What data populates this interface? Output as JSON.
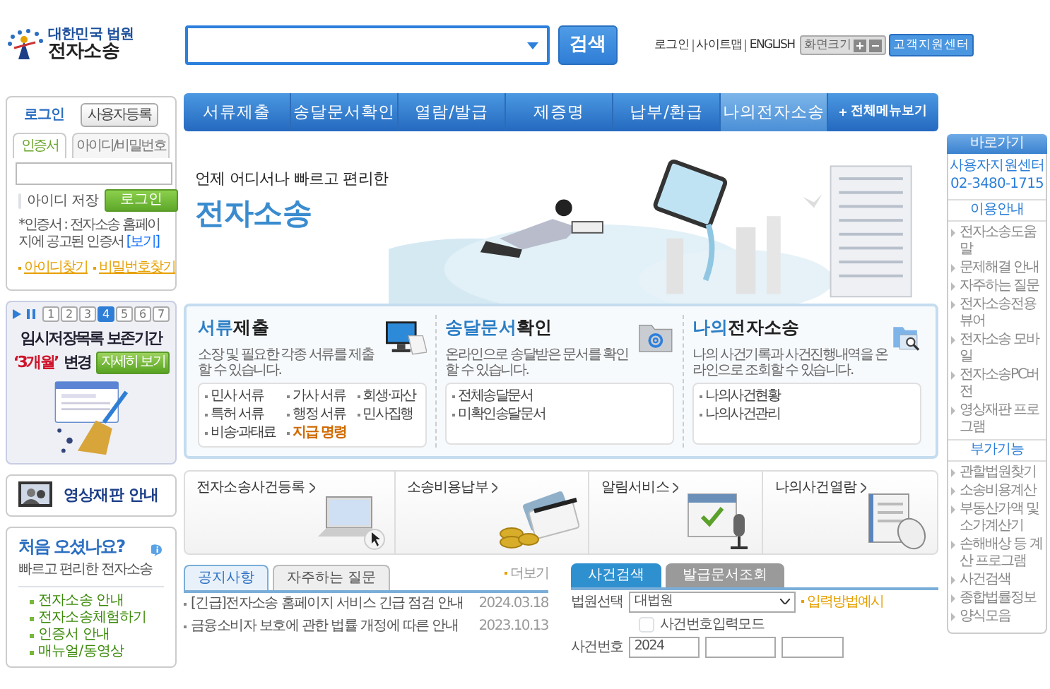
{
  "header": {
    "logo_sub": "대한민국 법원",
    "logo_title": "전자소송",
    "search_button": "검색",
    "util_links": [
      "로그인",
      "사이트맵",
      "ENGLISH"
    ],
    "font_size_label": "화면크기",
    "support_button": "고객지원센터"
  },
  "nav": {
    "items": [
      {
        "label": "서류제출",
        "selected": false
      },
      {
        "label": "송달문서확인",
        "selected": false
      },
      {
        "label": "열람/발급",
        "selected": false
      },
      {
        "label": "제증명",
        "selected": false
      },
      {
        "label": "납부/환급",
        "selected": false
      },
      {
        "label": "나의전자소송",
        "selected": true
      }
    ],
    "all_menu": "전체메뉴보기"
  },
  "login": {
    "title": "로그인",
    "register_button": "사용자등록",
    "tabs": [
      {
        "label": "인증서",
        "selected": true
      },
      {
        "label": "아이디/비밀번호",
        "selected": false
      }
    ],
    "save_id": {
      "label": "아이디 저장",
      "checked": false
    },
    "login_button": "로그인",
    "note": "*인증서 : 전자소송 홈페이지에 공고된 인증서",
    "note_link": "[보기]",
    "links": [
      "아이디찾기",
      "비밀번호찾기"
    ]
  },
  "promo": {
    "pages": [
      {
        "label": "1",
        "selected": false
      },
      {
        "label": "2",
        "selected": false
      },
      {
        "label": "3",
        "selected": false
      },
      {
        "label": "4",
        "selected": true
      },
      {
        "label": "5",
        "selected": false
      },
      {
        "label": "6",
        "selected": false
      },
      {
        "label": "7",
        "selected": false
      }
    ],
    "title": "임시저장목록 보존기간",
    "highlight": "‘3개월’",
    "suffix": "변경",
    "button": "자세히 보기"
  },
  "video_trial": "영상재판 안내",
  "first_visit": {
    "title": "처음 오셨나요?",
    "subtitle": "빠르고 편리한 전자소송",
    "links": [
      "전자소송 안내",
      "전자소송체험하기",
      "인증서 안내",
      "매뉴얼/동영상"
    ]
  },
  "banner": {
    "tagline": "언제 어디서나 빠르고 편리한",
    "title": "전자소송"
  },
  "services": [
    {
      "title_accent": "서류",
      "title_rest": "제출",
      "kind": "monitor",
      "desc": "소장 및 필요한 각종 서류를 제출할 수 있습니다.",
      "links": [
        {
          "label": "민사 서류",
          "highlight": false
        },
        {
          "label": "가사 서류",
          "highlight": false
        },
        {
          "label": "회생·파산",
          "highlight": false
        },
        {
          "label": "특허 서류",
          "highlight": false
        },
        {
          "label": "행정 서류",
          "highlight": false
        },
        {
          "label": "민사집행",
          "highlight": false
        },
        {
          "label": "비송·과태료",
          "highlight": false
        },
        {
          "label": "지급 명령",
          "highlight": true
        }
      ]
    },
    {
      "title_accent": "송달문서",
      "title_rest": "확인",
      "kind": "mail-folder",
      "desc": "온라인으로 송달받은 문서를 확인 할 수 있습니다.",
      "links": [
        {
          "label": "전체송달문서",
          "highlight": false
        },
        {
          "label": "미확인송달문서",
          "highlight": false
        }
      ]
    },
    {
      "title_accent": "나의",
      "title_rest": "전자소송",
      "kind": "folder-search",
      "desc": "나의 사건기록과 사건진행내역을 온라인으로 조회할 수 있습니다.",
      "links": [
        {
          "label": "나의사건현황",
          "highlight": false
        },
        {
          "label": "나의사건관리",
          "highlight": false
        }
      ]
    }
  ],
  "quick_links": [
    {
      "label": "전자소송사건등록",
      "kind": "laptop"
    },
    {
      "label": "소송비용납부",
      "kind": "payment"
    },
    {
      "label": "알림서비스",
      "kind": "alert"
    },
    {
      "label": "나의사건열람",
      "kind": "document"
    }
  ],
  "notices": {
    "tabs": [
      {
        "label": "공지사항",
        "selected": true
      },
      {
        "label": "자주하는 질문",
        "selected": false
      }
    ],
    "more": "더보기",
    "items": [
      {
        "title": "[긴급]전자소송 홈페이지 서비스 긴급 점검 안내",
        "date": "2024.03.18"
      },
      {
        "title": "금융소비자 보호에 관한 법률 개정에 따른 안내",
        "date": "2023.10.13"
      }
    ]
  },
  "case_search": {
    "tabs": [
      {
        "label": "사건검색",
        "selected": true
      },
      {
        "label": "발급문서조회",
        "selected": false
      }
    ],
    "court_label": "법원선택",
    "court_value": "대법원",
    "input_help": "입력방법예시",
    "mode": {
      "label": "사건번호입력모드",
      "checked": false
    },
    "case_label": "사건번호",
    "year": "2024"
  },
  "quick_menu": {
    "title": "바로가기",
    "support": "사용자지원센터",
    "phone": "02-3480-1715",
    "sections": [
      {
        "title": "이용안내",
        "items": [
          "전자소송도움말",
          "문제해결 안내",
          "자주하는 질문",
          "전자소송전용뷰어",
          "전자소송 모바일",
          "전자소송PC버전",
          "영상재판 프로그램"
        ]
      },
      {
        "title": "부가기능",
        "items": [
          "관할법원찾기",
          "소송비용계산",
          "부동산가액 및 소가계산기",
          "손해배상 등 계산 프로그램",
          "사건검색",
          "종합법률정보",
          "양식모음"
        ]
      }
    ]
  }
}
